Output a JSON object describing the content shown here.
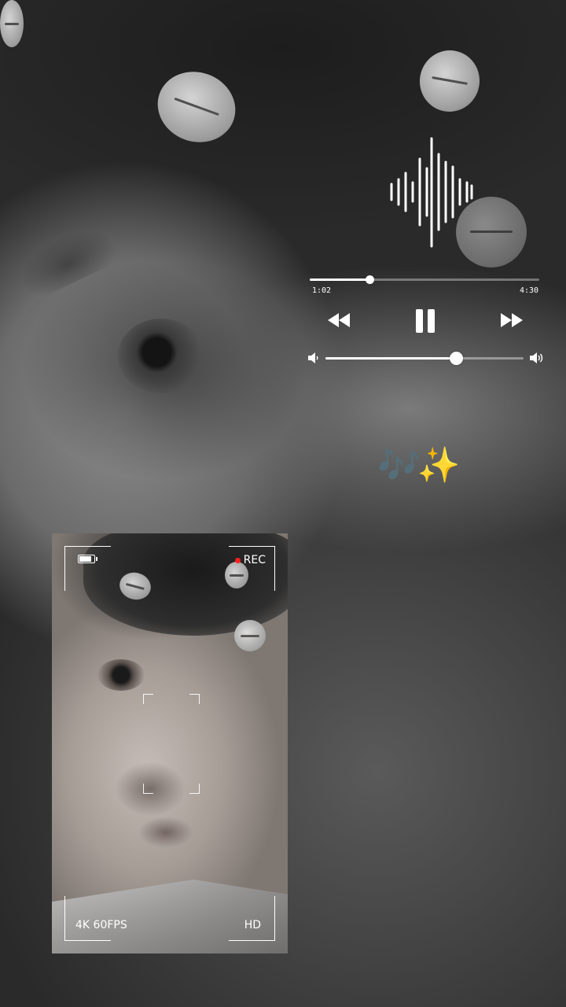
{
  "player": {
    "current_time": "1:02",
    "total_time": "4:30",
    "progress_fraction": 0.26,
    "volume_fraction": 0.66,
    "rewind_icon": "rewind-icon",
    "pause_icon": "pause-icon",
    "forward_icon": "fast-forward-icon",
    "volume_low_icon": "volume-low-icon",
    "volume_high_icon": "volume-high-icon"
  },
  "emoji_text": "🎶✨",
  "camera": {
    "rec_label": "REC",
    "resolution_label": "4K 60FPS",
    "quality_label": "HD",
    "battery_level": 0.85,
    "rec_color": "#ff2020"
  }
}
